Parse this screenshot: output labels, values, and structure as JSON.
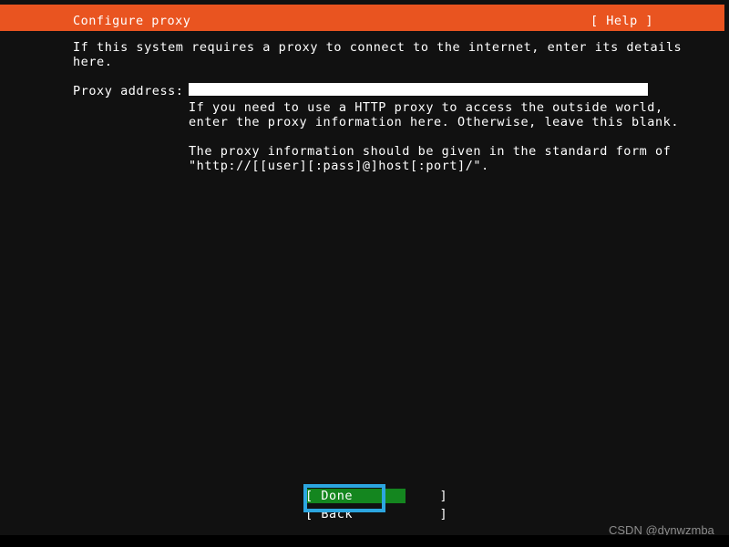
{
  "window": {
    "title": "Configure proxy"
  },
  "header": {
    "title": "Configure proxy",
    "help_label": "[ Help ]",
    "background_color": "#e95420",
    "text_color": "#ffffff"
  },
  "main": {
    "intro_text": "If this system requires a proxy to connect to the internet, enter its details\nhere.",
    "proxy_field": {
      "label": "Proxy address:",
      "value": "",
      "placeholder": ""
    },
    "help_paragraph_1": "If you need to use a HTTP proxy to access the outside world,\nenter the proxy information here. Otherwise, leave this blank.",
    "help_paragraph_2": "The proxy information should be given in the standard form of\n\"http://[[user][:pass]@]host[:port]/\"."
  },
  "buttons": {
    "done_label": "[ Done           ]",
    "back_label": "[ Back           ]",
    "done_selected": true,
    "selection_color": "#14861f"
  },
  "annotation": {
    "highlight_color": "#2ca6e0"
  },
  "watermark": {
    "text": "CSDN @dynwzmba",
    "color": "#8c8c8c"
  },
  "theme": {
    "background_color": "#111111",
    "foreground_color": "#ffffff",
    "input_background": "#ffffff"
  }
}
